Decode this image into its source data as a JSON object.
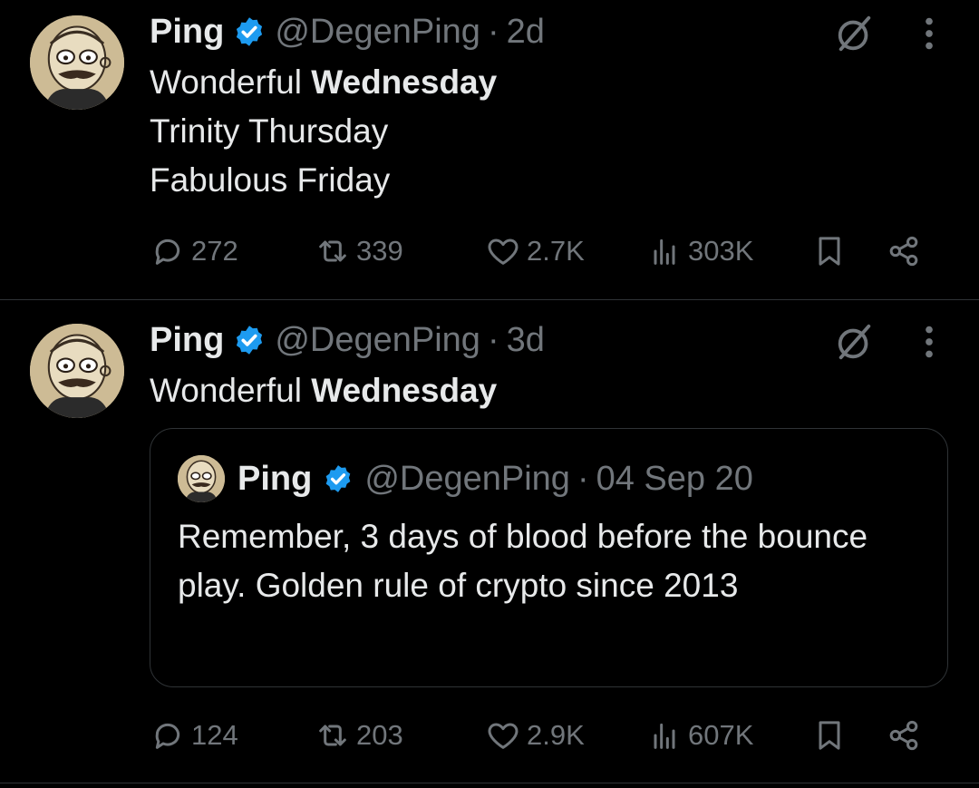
{
  "tweets": [
    {
      "author": {
        "name": "Ping",
        "handle": "@DegenPing",
        "verified": true
      },
      "separator": "·",
      "time": "2d",
      "lines": [
        {
          "normal": "Wonderful ",
          "bold": "Wednesday"
        },
        {
          "normal": "Trinity Thursday",
          "bold": ""
        },
        {
          "normal": "Fabulous Friday",
          "bold": ""
        }
      ],
      "stats": {
        "replies": "272",
        "reposts": "339",
        "likes": "2.7K",
        "views": "303K"
      }
    },
    {
      "author": {
        "name": "Ping",
        "handle": "@DegenPing",
        "verified": true
      },
      "separator": "·",
      "time": "3d",
      "lines": [
        {
          "normal": "Wonderful ",
          "bold": "Wednesday"
        }
      ],
      "quote": {
        "author": {
          "name": "Ping",
          "handle": "@DegenPing",
          "verified": true
        },
        "separator": "·",
        "time": "04 Sep 20",
        "text": "Remember, 3 days of blood before the bounce play. Golden rule of crypto since 2013"
      },
      "stats": {
        "replies": "124",
        "reposts": "203",
        "likes": "2.9K",
        "views": "607K"
      }
    }
  ],
  "colors": {
    "background": "#000000",
    "text": "#e7e9ea",
    "muted": "#71767b",
    "divider": "#2f3336",
    "verified": "#1d9bf0"
  },
  "icons": [
    "avatar",
    "verified-badge-icon",
    "grok-icon",
    "more-icon",
    "reply-icon",
    "repost-icon",
    "like-icon",
    "views-icon",
    "bookmark-icon",
    "share-icon"
  ]
}
